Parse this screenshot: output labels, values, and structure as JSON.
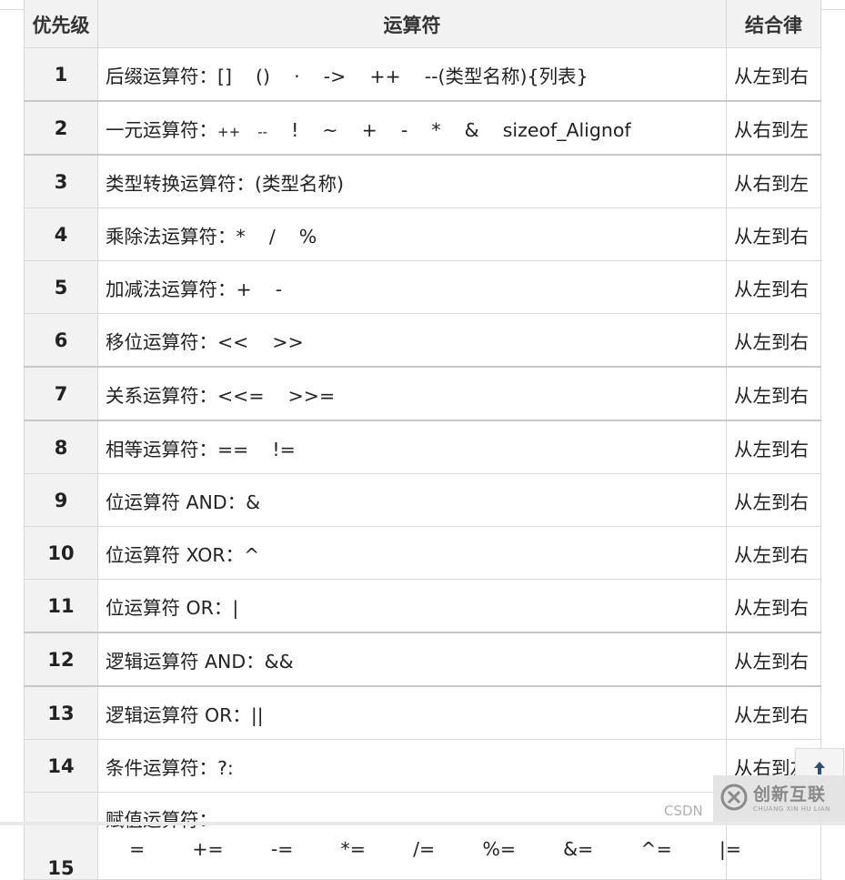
{
  "header": {
    "priority": "优先级",
    "operator": "运算符",
    "assoc": "结合律"
  },
  "rows": [
    {
      "pri": "1",
      "op": "后缀运算符：[]    ()    ·    ->    ++    --(类型名称){列表}",
      "assoc": "从左到右"
    },
    {
      "pri": "2",
      "op": "一元运算符：",
      "op_small": "++    --",
      "op_rest": "    !    ~    +    -    *    &    sizeof_Alignof",
      "assoc": "从右到左"
    },
    {
      "pri": "3",
      "op": "类型转换运算符：(类型名称)",
      "assoc": "从右到左"
    },
    {
      "pri": "4",
      "op": "乘除法运算符：*    /    %",
      "assoc": "从左到右"
    },
    {
      "pri": "5",
      "op": "加减法运算符：+    -",
      "assoc": "从左到右"
    },
    {
      "pri": "6",
      "op": "移位运算符：<<    >>",
      "assoc": "从左到右"
    },
    {
      "pri": "7",
      "op": "关系运算符：<<=    >>=",
      "assoc": "从左到右"
    },
    {
      "pri": "8",
      "op": "相等运算符：==    !=",
      "assoc": "从左到右"
    },
    {
      "pri": "9",
      "op": "位运算符 AND：&",
      "assoc": "从左到右"
    },
    {
      "pri": "10",
      "op": "位运算符 XOR：^",
      "assoc": "从左到右"
    },
    {
      "pri": "11",
      "op": "位运算符 OR：|",
      "assoc": "从左到右"
    },
    {
      "pri": "12",
      "op": "逻辑运算符 AND：&&",
      "assoc": "从左到右"
    },
    {
      "pri": "13",
      "op": "逻辑运算符 OR：||",
      "assoc": "从左到右"
    },
    {
      "pri": "14",
      "op": "条件运算符：?:",
      "assoc": "从右到左"
    },
    {
      "pri": "15",
      "op": "赋值运算符：",
      "op_line2": "    =        +=        -=        *=        /=        %=        &=        ^=        |=",
      "assoc": ""
    }
  ],
  "watermark": {
    "csdn": "CSDN",
    "logo_title": "创新互联",
    "logo_sub": "CHUANG XIN HU LIAN"
  },
  "icons": {
    "scroll_top": "arrow-up-icon",
    "logo": "logo-x-icon"
  }
}
